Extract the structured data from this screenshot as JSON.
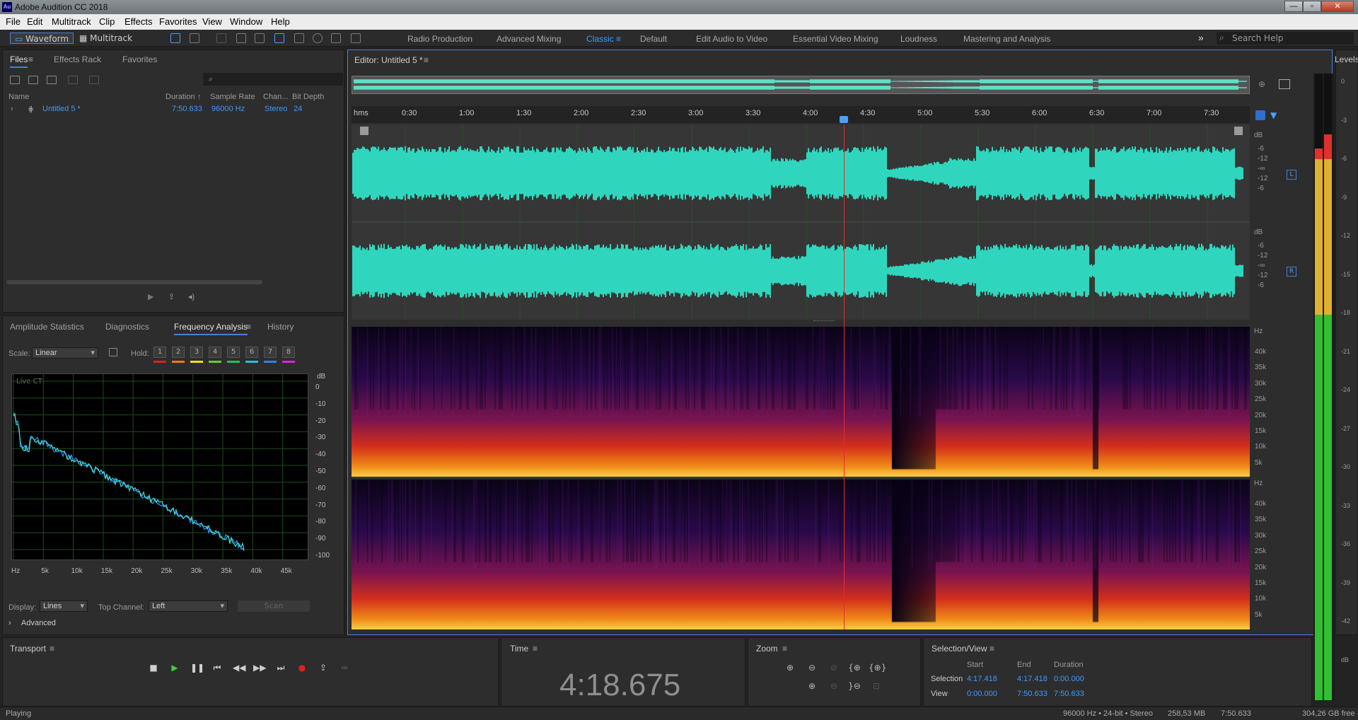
{
  "app": {
    "title": "Adobe Audition CC 2018",
    "logo": "Au"
  },
  "window_controls": {
    "minimize": "—",
    "maximize": "▫",
    "close": "✕"
  },
  "menu": [
    "File",
    "Edit",
    "Multitrack",
    "Clip",
    "Effects",
    "Favorites",
    "View",
    "Window",
    "Help"
  ],
  "toolbar": {
    "waveform": "Waveform",
    "multitrack": "Multitrack",
    "workspaces": [
      "Radio Production",
      "Advanced Mixing",
      "Classic",
      "Default",
      "Edit Audio to Video",
      "Essential Video Mixing",
      "Loudness",
      "Mastering and Analysis"
    ],
    "active_workspace": "Classic",
    "overflow": "»",
    "search_placeholder": "Search Help"
  },
  "files_panel": {
    "tabs": [
      "Files",
      "Effects Rack",
      "Favorites"
    ],
    "headers": {
      "name": "Name",
      "duration": "Duration",
      "duration_sort": "↑",
      "sample_rate": "Sample Rate",
      "channels": "Chan...",
      "bit_depth": "Bit Depth"
    },
    "row": {
      "name": "Untitled 5 *",
      "duration": "7:50.633",
      "sample_rate": "96000 Hz",
      "channels": "Stereo",
      "bit_depth": "24"
    }
  },
  "analysis_panel": {
    "tabs": [
      "Amplitude Statistics",
      "Diagnostics",
      "Frequency Analysis",
      "History"
    ],
    "active_tab": "Frequency Analysis",
    "scale_label": "Scale:",
    "scale_value": "Linear",
    "hold_label": "Hold:",
    "hold_buttons": [
      "1",
      "2",
      "3",
      "4",
      "5",
      "6",
      "7",
      "8"
    ],
    "hold_colors": [
      "#e02020",
      "#f07a10",
      "#f0e010",
      "#60d030",
      "#28c050",
      "#20c0e0",
      "#3080f0",
      "#e020e0"
    ],
    "live_label": "Live CTI",
    "y_unit": "dB",
    "y_labels": [
      "0",
      "-10",
      "-20",
      "-30",
      "-40",
      "-50",
      "-60",
      "-70",
      "-80",
      "-90",
      "-100"
    ],
    "x_labels": [
      "Hz",
      "5k",
      "10k",
      "15k",
      "20k",
      "25k",
      "30k",
      "35k",
      "40k",
      "45k"
    ],
    "display_label": "Display:",
    "display_value": "Lines",
    "top_channel_label": "Top Channel:",
    "top_channel_value": "Left",
    "scan_label": "Scan",
    "advanced_label": "Advanced"
  },
  "editor": {
    "title": "Editor: Untitled 5 *",
    "ruler_unit": "hms",
    "ruler_labels": [
      "0:30",
      "1:00",
      "1:30",
      "2:00",
      "2:30",
      "3:00",
      "3:30",
      "4:00",
      "4:30",
      "5:00",
      "5:30",
      "6:00",
      "6:30",
      "7:00",
      "7:30"
    ],
    "db_unit": "dB",
    "db_labels": [
      "-6",
      "-12",
      "-∞",
      "-12",
      "-6"
    ],
    "channel_left": "L",
    "channel_right": "R",
    "hz_unit": "Hz",
    "hz_labels": [
      "40k",
      "35k",
      "30k",
      "25k",
      "20k",
      "15k",
      "10k",
      "5k"
    ]
  },
  "levels": {
    "title": "Levels",
    "labels": [
      "0",
      "-3",
      "-6",
      "-9",
      "-12",
      "-15",
      "-18",
      "-21",
      "-24",
      "-27",
      "-30",
      "-33",
      "-36",
      "-39",
      "-42",
      "dB"
    ]
  },
  "transport": {
    "title": "Transport"
  },
  "time": {
    "title": "Time",
    "value": "4:18.675"
  },
  "zoom": {
    "title": "Zoom"
  },
  "selection_view": {
    "title": "Selection/View",
    "col_start": "Start",
    "col_end": "End",
    "col_duration": "Duration",
    "selection_label": "Selection",
    "selection_start": "4:17.418",
    "selection_end": "4:17.418",
    "selection_duration": "0:00.000",
    "view_label": "View",
    "view_start": "0:00.000",
    "view_end": "7:50.633",
    "view_duration": "7:50.633"
  },
  "status": {
    "state": "Playing",
    "format": "96000 Hz • 24-bit • Stereo",
    "size": "258,53 MB",
    "duration": "7:50.633",
    "free": "304,26 GB free"
  }
}
